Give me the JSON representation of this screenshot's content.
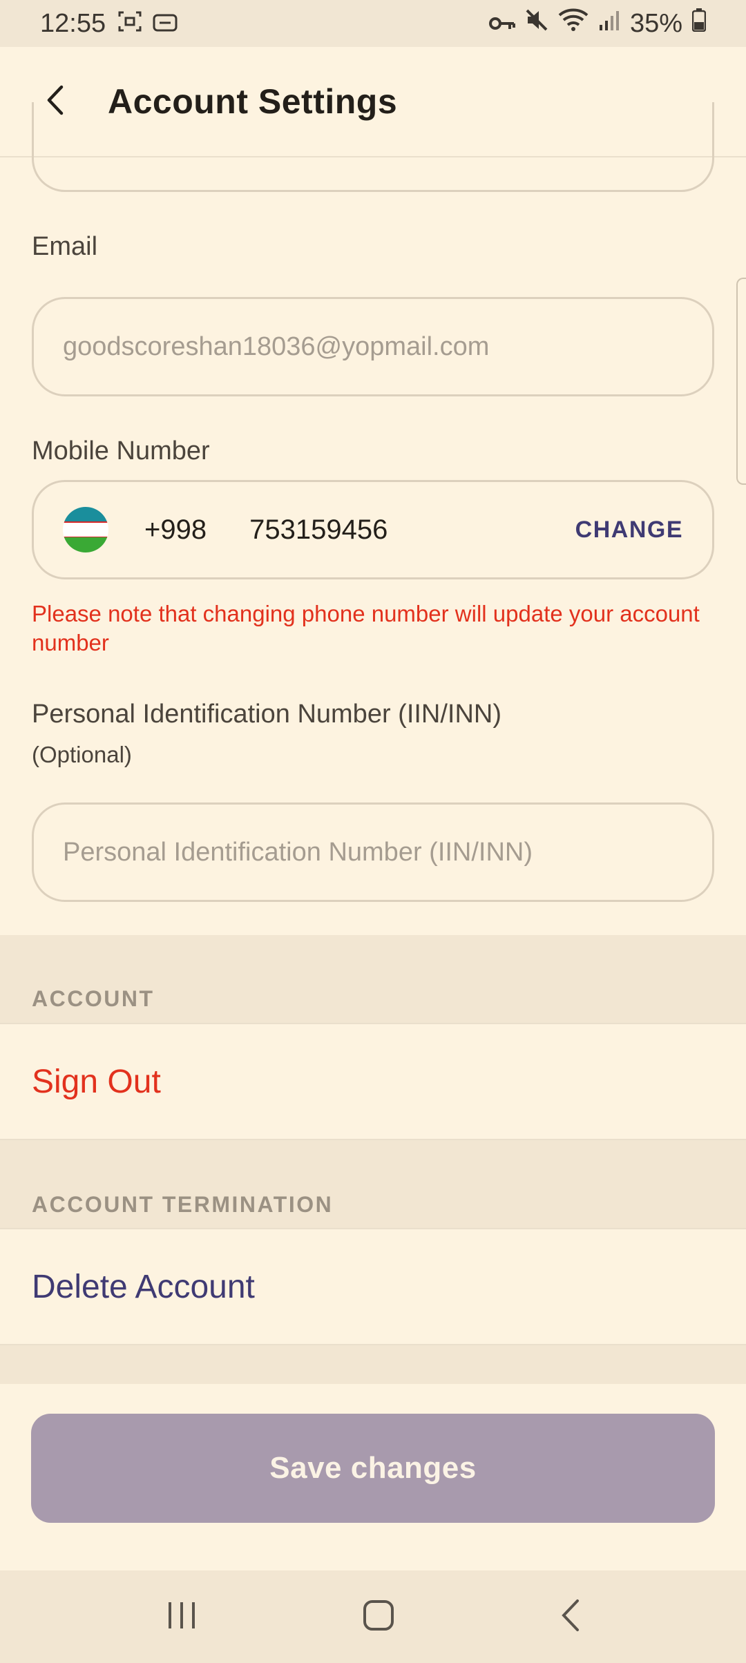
{
  "status_bar": {
    "time": "12:55",
    "battery": "35%"
  },
  "header": {
    "title": "Account Settings"
  },
  "form": {
    "email_label": "Email",
    "email_value": "goodscoreshan18036@yopmail.com",
    "mobile_label": "Mobile Number",
    "country_code": "+998",
    "phone_number": "753159456",
    "change_label": "CHANGE",
    "phone_warning": "Please note that changing phone number will update your account number",
    "pin_label": "Personal Identification Number (IIN/INN)",
    "pin_optional": "(Optional)",
    "pin_placeholder": "Personal Identification Number (IIN/INN)"
  },
  "sections": {
    "account_header": "ACCOUNT",
    "sign_out": "Sign Out",
    "termination_header": "ACCOUNT TERMINATION",
    "delete_account": "Delete Account"
  },
  "actions": {
    "save_label": "Save changes"
  },
  "colors": {
    "background": "#fdf3e0",
    "danger": "#e2311d",
    "accent": "#3f3a73",
    "save_disabled": "#a89aad"
  },
  "icons": [
    "back-arrow-icon",
    "recent-apps-icon",
    "home-icon",
    "nav-back-icon",
    "vpn-key-icon",
    "mute-icon",
    "wifi-icon",
    "signal-icon",
    "battery-icon",
    "screenshot-icon",
    "cast-icon"
  ]
}
